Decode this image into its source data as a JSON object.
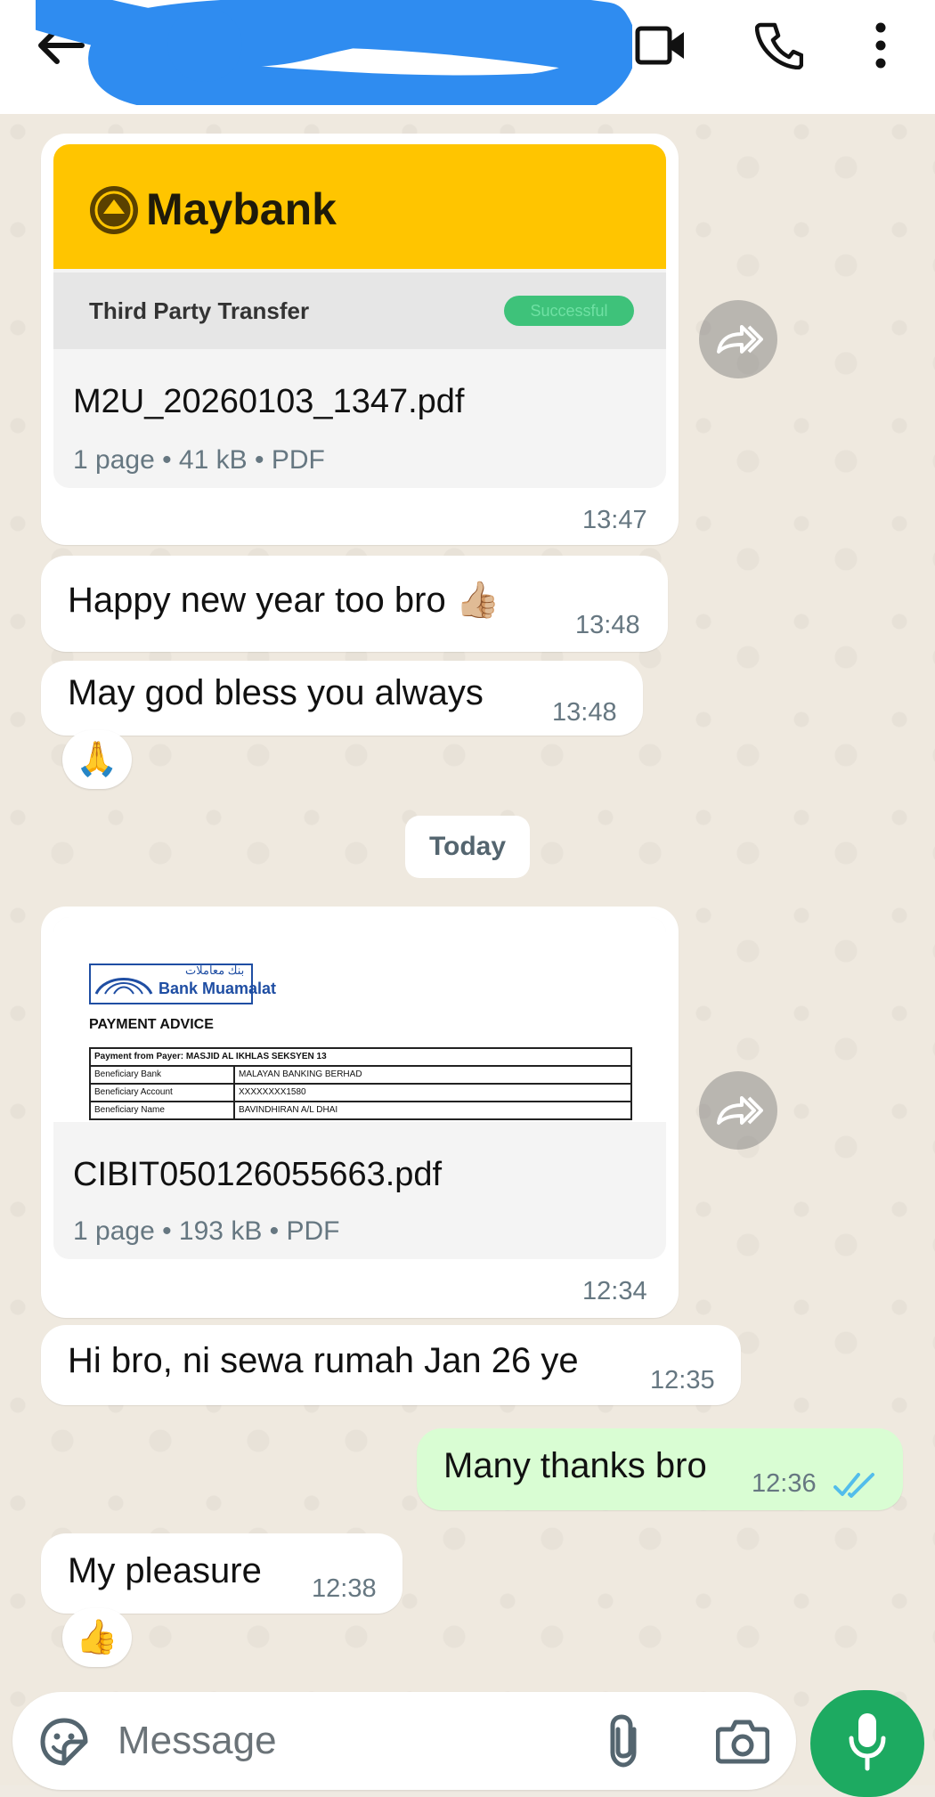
{
  "header": {
    "contact_name": "",
    "back_icon": "arrow-left-icon",
    "video_icon": "video-camera-icon",
    "call_icon": "phone-icon",
    "menu_icon": "more-vertical-icon"
  },
  "messages": {
    "doc1": {
      "brand": "Maybank",
      "subtitle": "Third Party Transfer",
      "status": "Successful",
      "filename": "M2U_20260103_1347.pdf",
      "meta": "1 page • 41 kB • PDF",
      "time": "13:47"
    },
    "m1": {
      "text": "Happy new year too bro 👍🏼",
      "time": "13:48"
    },
    "m2": {
      "text": "May god bless you always",
      "time": "13:48",
      "reaction": "🙏"
    },
    "day_divider": "Today",
    "doc2": {
      "bank_name": "Bank Muamalat",
      "bank_arabic": "بنك معاملات",
      "title": "PAYMENT ADVICE",
      "rows": [
        [
          "Payment from Payer: MASJID AL IKHLAS SEKSYEN 13",
          ""
        ],
        [
          "Beneficiary Bank",
          "MALAYAN BANKING BERHAD"
        ],
        [
          "Beneficiary Account",
          "XXXXXXXX1580"
        ],
        [
          "Beneficiary Name",
          "BAVINDHIRAN A/L DHAI"
        ]
      ],
      "filename": "CIBIT050126055663.pdf",
      "meta": "1 page • 193 kB • PDF",
      "time": "12:34"
    },
    "m3": {
      "text": "Hi bro, ni sewa rumah Jan 26 ye",
      "time": "12:35"
    },
    "m4": {
      "text": "Many thanks bro",
      "time": "12:36",
      "status": "read"
    },
    "m5": {
      "text": "My pleasure",
      "time": "12:38",
      "reaction": "👍"
    }
  },
  "composer": {
    "placeholder": "Message",
    "sticker_icon": "sticker-icon",
    "attach_icon": "paperclip-icon",
    "camera_icon": "camera-icon",
    "mic_icon": "microphone-icon"
  },
  "colors": {
    "accent": "#1daa61",
    "read_ticks": "#53bdeb",
    "outgoing_bubble": "#d9fdd3",
    "maybank_yellow": "#ffc500"
  }
}
